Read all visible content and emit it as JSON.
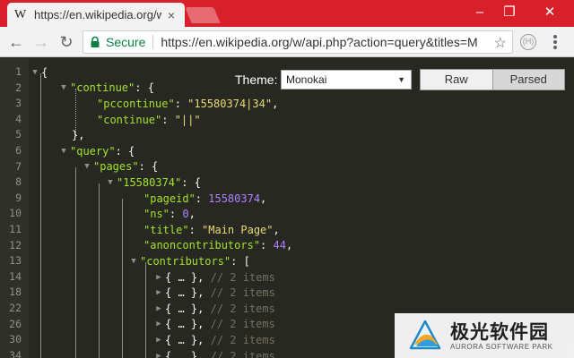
{
  "tab": {
    "favicon": "W",
    "title": "https://en.wikipedia.org/w/api.php",
    "close": "×"
  },
  "window": {
    "minimize": "–",
    "restore": "❐",
    "close": "✕"
  },
  "toolbar": {
    "back": "←",
    "forward": "→",
    "reload": "↻",
    "secure_label": "Secure",
    "url": "https://en.wikipedia.org/w/api.php?action=query&titles=M",
    "star": "☆",
    "extension": "(H)"
  },
  "viewer": {
    "theme_label": "Theme:",
    "theme_value": "Monokai",
    "raw_label": "Raw",
    "parsed_label": "Parsed"
  },
  "gutter": {
    "line_numbers": [
      "1",
      "2",
      "3",
      "4",
      "5",
      "6",
      "7",
      "8",
      "9",
      "10",
      "11",
      "12",
      "13",
      "14",
      "18",
      "22",
      "26",
      "30",
      "34"
    ]
  },
  "json": {
    "open_brace": "{",
    "continue_key": "\"continue\"",
    "pccontinue_key": "\"pccontinue\"",
    "pccontinue_val": "\"15580374|34\"",
    "continue_inner_key": "\"continue\"",
    "continue_inner_val": "\"||\"",
    "close_continue": "},",
    "query_key": "\"query\"",
    "pages_key": "\"pages\"",
    "page_id_key": "\"15580374\"",
    "pageid_key": "\"pageid\"",
    "pageid_val": "15580374",
    "ns_key": "\"ns\"",
    "ns_val": "0",
    "title_key": "\"title\"",
    "title_val": "\"Main Page\"",
    "anon_key": "\"anoncontributors\"",
    "anon_val": "44",
    "contributors_key": "\"contributors\"",
    "collapsed_item": "{ … },",
    "collapsed_comment": "// 2 items"
  },
  "watermark": {
    "cn": "极光软件园",
    "en": "AURORA SOFTWARE PARK"
  },
  "colors": {
    "tabstrip": "#d8202b",
    "background": "#272822",
    "key": "#a6e22e",
    "string": "#e6db74",
    "number": "#ae81ff",
    "comment": "#75715e"
  }
}
